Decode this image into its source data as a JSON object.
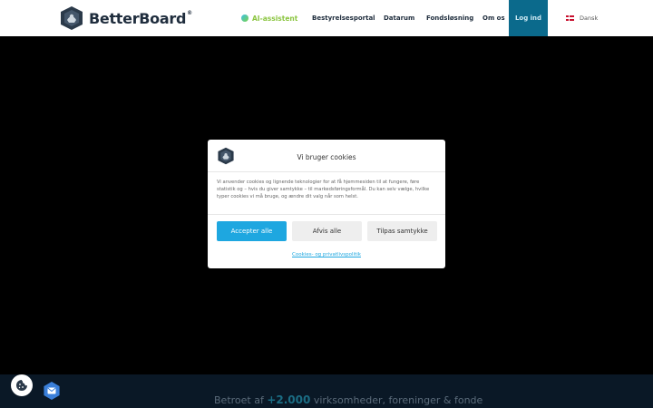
{
  "header": {
    "brand": "BetterBoard",
    "brand_mark": "®",
    "ai_label": "AI-assistent",
    "nav": [
      {
        "label": "Bestyrelsesportal"
      },
      {
        "label": "Datarum"
      },
      {
        "label": "Fondsløsning"
      },
      {
        "label": "Om os"
      }
    ],
    "login_label": "Log ind",
    "language": "Dansk"
  },
  "modal": {
    "title": "Vi bruger cookies",
    "body": "Vi anvender cookies og lignende teknologier for at få hjemmesiden til at fungere, føre statistik og – hvis du giver samtykke – til markedsføringsformål. Du kan selv vælge, hvilke typer cookies vi må bruge, og ændre dit valg når som helst.",
    "accept_label": "Accepter alle",
    "deny_label": "Afvis alle",
    "customize_label": "Tilpas samtykke",
    "policy_link": "Cookies- og privatlivspolitik"
  },
  "footer_band": {
    "prefix": "Betroet af",
    "number": "+2.000",
    "suffix": "virksomheder, foreninger & fonde"
  },
  "icons": {
    "logo": "shield-logo-icon",
    "ai": "ai-icon",
    "flag": "danish-flag-icon",
    "cookie": "cookie-icon",
    "mail": "mail-icon"
  },
  "colors": {
    "accent": "#1ea7e0",
    "login_bg": "#0b6a8c",
    "ai_green": "#8bc540",
    "overlay": "#000000"
  }
}
